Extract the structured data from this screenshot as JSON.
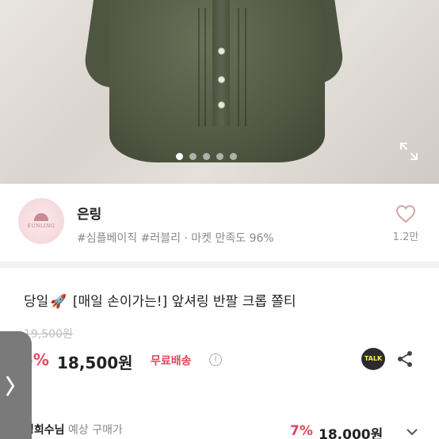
{
  "shop": {
    "name": "은링",
    "logo_text": "EUNLING",
    "tags": "#심플베이직 #러블리 · 마켓 만족도 96%",
    "likes": "1.2만"
  },
  "product": {
    "title_prefix": "당일",
    "title_main": "[매일 손이가는!] 앞셔링 반팔 크롭 쫄티",
    "original_price": "19,500원",
    "discount": "5%",
    "price": "18,500원",
    "shipping": "무료배송",
    "talk_label": "TALK"
  },
  "member": {
    "name": "경희수님",
    "label": "예상 구매가",
    "discount": "7%",
    "price": "18,000원"
  },
  "carousel": {
    "count": 5,
    "active_index": 0
  },
  "edge_handle_glyph": "〉",
  "colors": {
    "accent": "#e5455a",
    "shirt": "#545b45"
  }
}
